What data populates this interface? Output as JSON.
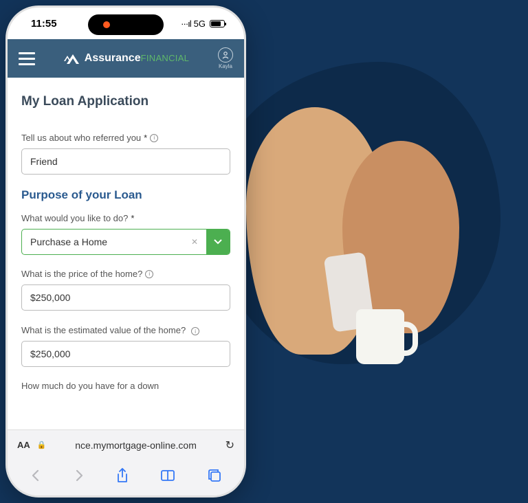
{
  "statusbar": {
    "time": "11:55",
    "network": "5G"
  },
  "header": {
    "brand_primary": "Assurance",
    "brand_secondary": "FINANCIAL",
    "user_name": "Kayla"
  },
  "page": {
    "title": "My Loan Application",
    "referral": {
      "label": "Tell us about who referred you",
      "value": "Friend"
    },
    "section_title": "Purpose of your Loan",
    "purpose": {
      "label": "What would you like to do?",
      "value": "Purchase a Home"
    },
    "price": {
      "label": "What is the price of the home?",
      "value": "$250,000"
    },
    "est_value": {
      "label": "What is the estimated value of the home?",
      "value": "$250,000"
    },
    "down_payment": {
      "label": "How much do you have for a down"
    }
  },
  "browser": {
    "aa": "AA",
    "url": "nce.mymortgage-online.com"
  }
}
